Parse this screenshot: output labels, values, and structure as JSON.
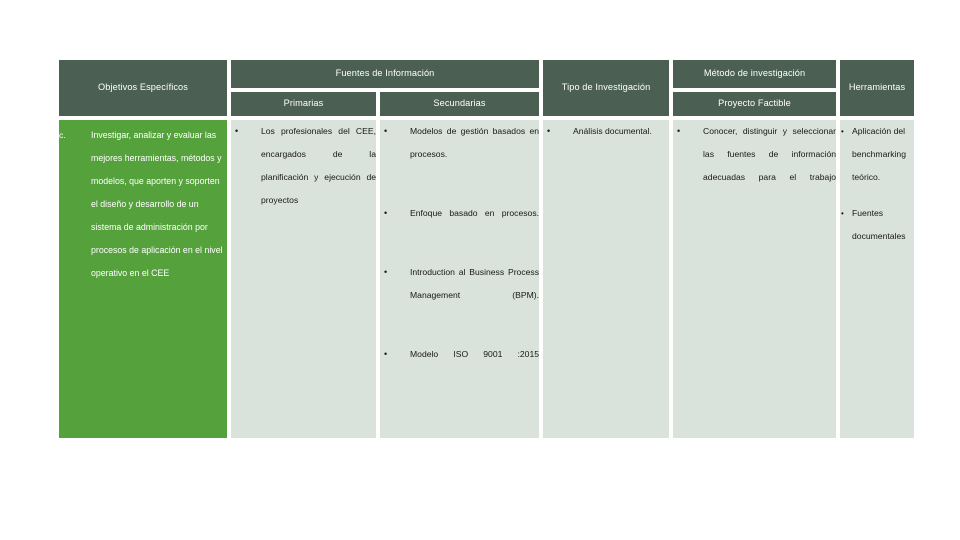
{
  "slide": {
    "background_color": "#FFFFFF",
    "table": {
      "header_bg": "#4B6053",
      "header_text_color": "#FFFFFF",
      "body_bg": "#D9E2DB",
      "accent_green": "#55A13C",
      "gridline_color": "#FFFFFF"
    }
  },
  "headers": {
    "objetivos": "Objetivos Específicos",
    "fuentes": "Fuentes de Información",
    "primarias": "Primarias",
    "secundarias": "Secundarias",
    "tipo": "Tipo de Investigación",
    "metodo": "Método de investigación",
    "proyecto_factible": "Proyecto Factible",
    "herramientas": "Herramientas"
  },
  "row": {
    "objetivo": {
      "marker": "c.",
      "text": "Investigar, analizar y evaluar las mejores herramientas, métodos y modelos, que  aporten y soporten el diseño y desarrollo de un sistema de administración por procesos de aplicación en el nivel operativo en el CEE"
    },
    "primarias": {
      "bullet_glyph": "•",
      "items": [
        "Los profesionales del CEE, encargados de la planificación y ejecución de proyectos"
      ]
    },
    "secundarias": {
      "bullet_glyph": "•",
      "items": [
        "Modelos de gestión basados en procesos.",
        "Enfoque basado en procesos.",
        "Introduction al Business Process Management (BPM).",
        "Modelo ISO 9001 :2015"
      ]
    },
    "tipo": {
      "bullet_glyph": "•",
      "items": [
        "Análisis documental."
      ]
    },
    "proyecto_factible": {
      "bullet_glyph": "•",
      "items": [
        "Conocer, distinguir y seleccionar las fuentes de información adecuadas para el trabajo"
      ]
    },
    "herramientas": {
      "bullet_glyph": "•",
      "items": [
        "Aplicación del benchmarking teórico.",
        "Fuentes documentales"
      ]
    }
  }
}
